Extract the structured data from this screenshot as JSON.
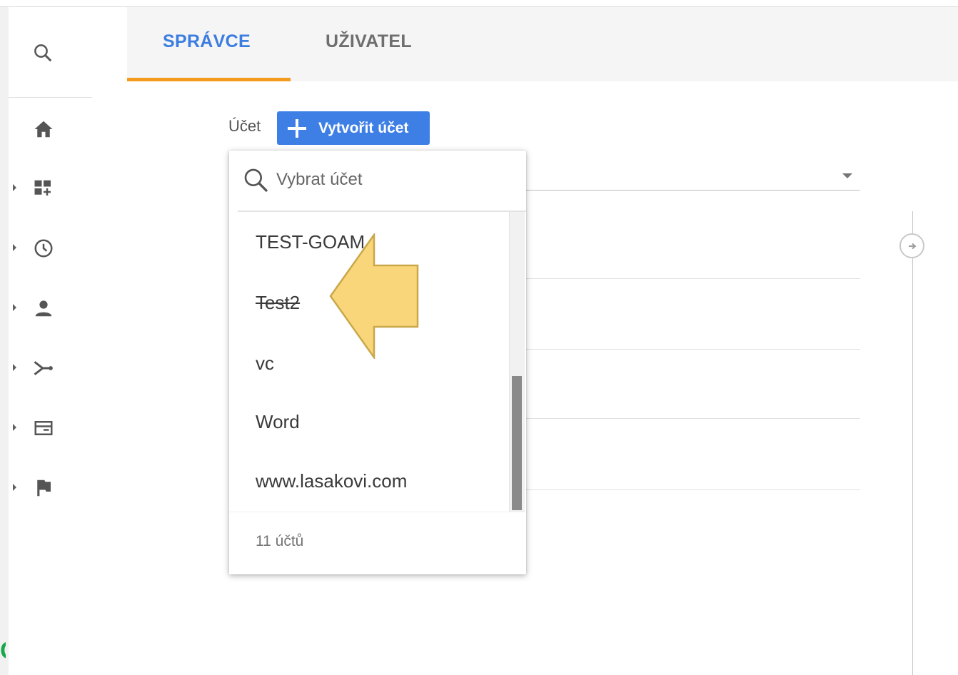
{
  "tabs": [
    {
      "label": "SPRÁVCE",
      "active": true
    },
    {
      "label": "UŽIVATEL",
      "active": false
    }
  ],
  "sidebar": {
    "items": [
      {
        "icon": "search-icon"
      },
      {
        "icon": "home-icon"
      },
      {
        "icon": "dashboard-add-icon"
      },
      {
        "icon": "clock-icon"
      },
      {
        "icon": "person-icon"
      },
      {
        "icon": "acquisition-icon"
      },
      {
        "icon": "behavior-icon"
      },
      {
        "icon": "flag-icon"
      }
    ],
    "partial_char": "C"
  },
  "account": {
    "label": "Účet",
    "create_button": "Vytvořit účet"
  },
  "dropdown": {
    "search_placeholder": "Vybrat účet",
    "items": [
      {
        "label": "TEST-GOAM",
        "strikethrough": false
      },
      {
        "label": "Test2",
        "strikethrough": true
      },
      {
        "label": "vc",
        "strikethrough": false
      },
      {
        "label": "Word",
        "strikethrough": false
      },
      {
        "label": "www.lasakovi.com",
        "strikethrough": false
      }
    ],
    "count_label": "11 účtů"
  },
  "colors": {
    "accent_blue": "#3e7fe6",
    "tab_underline": "#f49a1c",
    "arrow_fill": "#fad67a",
    "arrow_stroke": "#c9a84a"
  }
}
